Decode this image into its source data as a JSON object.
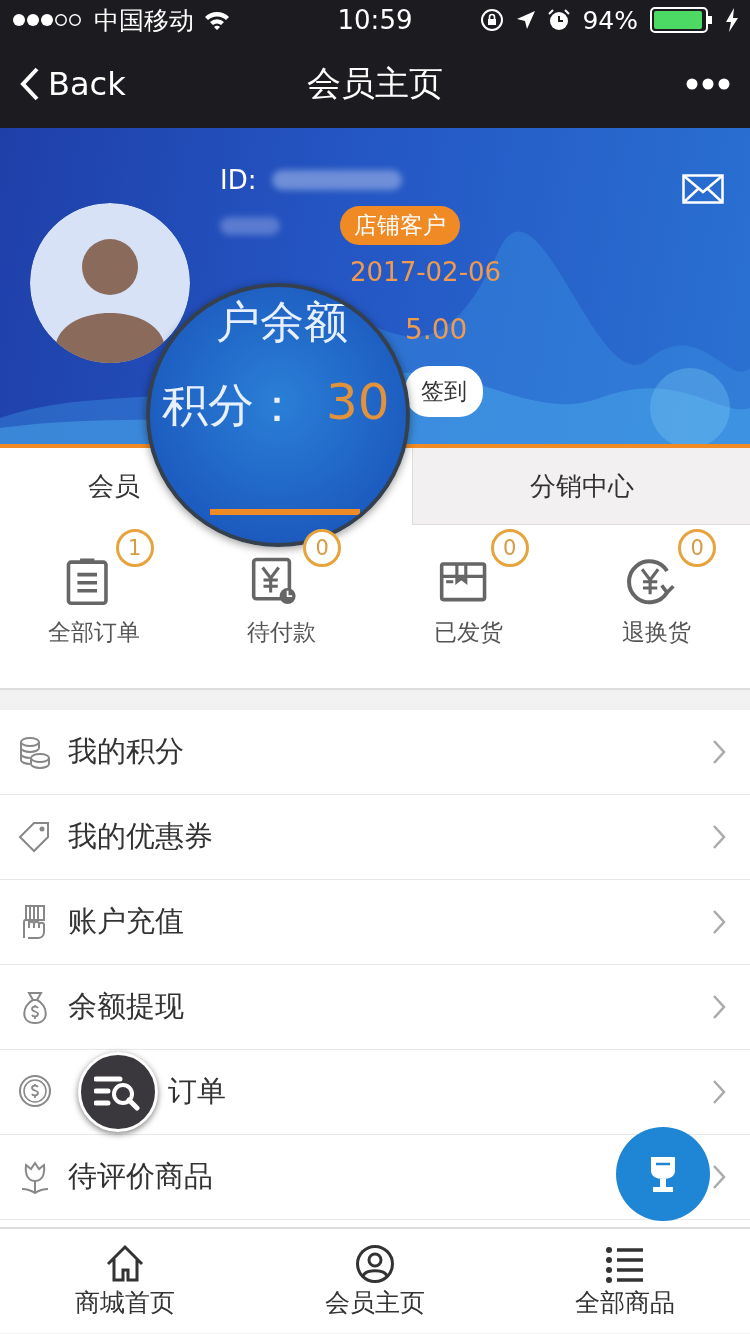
{
  "status_bar": {
    "carrier": "中国移动",
    "time": "10:59",
    "battery": "94%"
  },
  "nav": {
    "back": "Back",
    "title": "会员主页"
  },
  "profile": {
    "id_label": "ID:",
    "badge": "店铺客户",
    "date": "2017-02-06",
    "balance": "5.00",
    "checkin_button": "签到"
  },
  "magnifier": {
    "balance_label": "户余额",
    "points_label": "积分：",
    "points": "30"
  },
  "tabs": [
    {
      "label": "会员",
      "selected": true
    },
    {
      "label": "分销中心",
      "selected": false
    }
  ],
  "orders": [
    {
      "label": "全部订单",
      "count": "1",
      "kind": "list"
    },
    {
      "label": "待付款",
      "count": "0",
      "kind": "unpaid"
    },
    {
      "label": "已发货",
      "count": "0",
      "kind": "shipped"
    },
    {
      "label": "退换货",
      "count": "0",
      "kind": "return"
    }
  ],
  "menu": [
    {
      "label": "我的积分",
      "kind": "coins",
      "search_overlay": false
    },
    {
      "label": "我的优惠券",
      "kind": "tag",
      "search_overlay": false
    },
    {
      "label": "账户充值",
      "kind": "card",
      "search_overlay": false
    },
    {
      "label": "余额提现",
      "kind": "bag",
      "search_overlay": false
    },
    {
      "label": "订单",
      "kind": "coin",
      "search_overlay": true
    },
    {
      "label": "待评价商品",
      "kind": "flower",
      "search_overlay": false
    }
  ],
  "bottom_nav": [
    {
      "label": "商城首页",
      "kind": "home"
    },
    {
      "label": "会员主页",
      "kind": "user"
    },
    {
      "label": "全部商品",
      "kind": "list"
    }
  ]
}
